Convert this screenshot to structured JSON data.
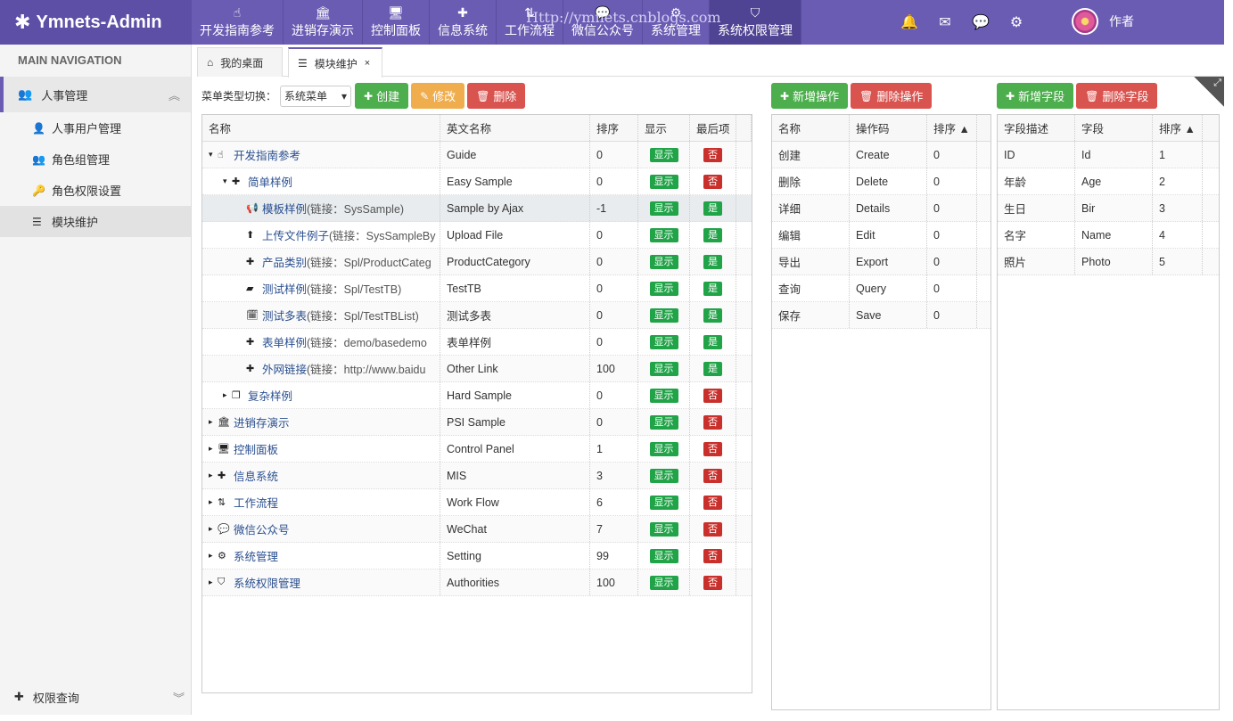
{
  "app": {
    "title": "Ymnets-Admin",
    "watermark": "Http://ymnets.cnblogs.com"
  },
  "topmenu": [
    {
      "label": "开发指南参考",
      "icon": "hand-pointer-icon",
      "glyph": "☝"
    },
    {
      "label": "进销存演示",
      "icon": "bank-icon",
      "glyph": "🏛"
    },
    {
      "label": "控制面板",
      "icon": "desktop-icon",
      "glyph": "🖥"
    },
    {
      "label": "信息系统",
      "icon": "puzzle-icon",
      "glyph": "✚"
    },
    {
      "label": "工作流程",
      "icon": "sort-icon",
      "glyph": "⇅"
    },
    {
      "label": "微信公众号",
      "icon": "wechat-icon",
      "glyph": "💬"
    },
    {
      "label": "系统管理",
      "icon": "cogs-icon",
      "glyph": "⚙"
    },
    {
      "label": "系统权限管理",
      "icon": "shield-icon",
      "glyph": "⛉"
    }
  ],
  "topicons": {
    "bell": "🔔",
    "mail": "✉",
    "chat": "💬",
    "gear": "⚙"
  },
  "user": {
    "name": "作者"
  },
  "sidebar": {
    "heading": "MAIN NAVIGATION",
    "group": {
      "label": "人事管理",
      "icon": "users-icon",
      "glyph": "👥",
      "chev": "︽"
    },
    "items": [
      {
        "label": "人事用户管理",
        "glyph": "👤"
      },
      {
        "label": "角色组管理",
        "glyph": "👥"
      },
      {
        "label": "角色权限设置",
        "glyph": "🔑"
      },
      {
        "label": "模块维护",
        "glyph": "☰"
      }
    ],
    "bottom": {
      "label": "权限查询",
      "glyph": "✚",
      "chev": "︾"
    }
  },
  "tabs": [
    {
      "label": "我的桌面",
      "glyph": "⌂"
    },
    {
      "label": "模块维护",
      "glyph": "☰",
      "close": "×"
    }
  ],
  "toolbar1": {
    "label": "菜单类型切换：",
    "select": "系统菜单",
    "select_arrow": "▾",
    "create": "创建",
    "edit": "修改",
    "delete": "删除",
    "plus": "✚",
    "pencil": "✎",
    "trash": "🗑"
  },
  "toolbar2": {
    "add": "新增操作",
    "delete": "删除操作",
    "plus": "✚",
    "trash": "🗑"
  },
  "toolbar3": {
    "add": "新增字段",
    "delete": "删除字段",
    "plus": "✚",
    "trash": "🗑"
  },
  "corner": "⤢",
  "modules": {
    "headers": [
      "名称",
      "英文名称",
      "排序",
      "显示",
      "最后项"
    ],
    "rows": [
      {
        "arrow": "▾",
        "indent": 0,
        "glyph": "☝",
        "name": "开发指南参考",
        "link": "",
        "en": "Guide",
        "sort": "0",
        "show": "显示",
        "last": "否"
      },
      {
        "arrow": "▾",
        "indent": 1,
        "glyph": "✚",
        "name": "简单样例",
        "link": "",
        "en": "Easy Sample",
        "sort": "0",
        "show": "显示",
        "last": "否"
      },
      {
        "arrow": "",
        "indent": 2,
        "glyph": "📢",
        "name": "模板样例",
        "link": " (链接：SysSample)",
        "en": "Sample by Ajax",
        "sort": "-1",
        "show": "显示",
        "last": "是"
      },
      {
        "arrow": "",
        "indent": 2,
        "glyph": "⬆",
        "name": "上传文件例子",
        "link": " (链接：SysSampleBy",
        "en": "Upload File",
        "sort": "0",
        "show": "显示",
        "last": "是"
      },
      {
        "arrow": "",
        "indent": 2,
        "glyph": "✚",
        "name": "产品类别",
        "link": " (链接：Spl/ProductCateg",
        "en": "ProductCategory",
        "sort": "0",
        "show": "显示",
        "last": "是"
      },
      {
        "arrow": "",
        "indent": 2,
        "glyph": "▰",
        "name": "测试样例",
        "link": " (链接：Spl/TestTB)",
        "en": "TestTB",
        "sort": "0",
        "show": "显示",
        "last": "是"
      },
      {
        "arrow": "",
        "indent": 2,
        "glyph": "🗓",
        "name": "测试多表",
        "link": " (链接：Spl/TestTBList)",
        "en": "测试多表",
        "sort": "0",
        "show": "显示",
        "last": "是"
      },
      {
        "arrow": "",
        "indent": 2,
        "glyph": "✚",
        "name": "表单样例",
        "link": " (链接：demo/basedemo",
        "en": "表单样例",
        "sort": "0",
        "show": "显示",
        "last": "是"
      },
      {
        "arrow": "",
        "indent": 2,
        "glyph": "✚",
        "name": "外网链接",
        "link": " (链接：http://www.baidu",
        "en": "Other Link",
        "sort": "100",
        "show": "显示",
        "last": "是"
      },
      {
        "arrow": "▸",
        "indent": 1,
        "glyph": "❐",
        "name": "复杂样例",
        "link": "",
        "en": "Hard Sample",
        "sort": "0",
        "show": "显示",
        "last": "否"
      },
      {
        "arrow": "▸",
        "indent": 0,
        "glyph": "🏛",
        "name": "进销存演示",
        "link": "",
        "en": "PSI Sample",
        "sort": "0",
        "show": "显示",
        "last": "否"
      },
      {
        "arrow": "▸",
        "indent": 0,
        "glyph": "🖥",
        "name": "控制面板",
        "link": "",
        "en": "Control Panel",
        "sort": "1",
        "show": "显示",
        "last": "否"
      },
      {
        "arrow": "▸",
        "indent": 0,
        "glyph": "✚",
        "name": "信息系统",
        "link": "",
        "en": "MIS",
        "sort": "3",
        "show": "显示",
        "last": "否"
      },
      {
        "arrow": "▸",
        "indent": 0,
        "glyph": "⇅",
        "name": "工作流程",
        "link": "",
        "en": "Work Flow",
        "sort": "6",
        "show": "显示",
        "last": "否"
      },
      {
        "arrow": "▸",
        "indent": 0,
        "glyph": "💬",
        "name": "微信公众号",
        "link": "",
        "en": "WeChat",
        "sort": "7",
        "show": "显示",
        "last": "否"
      },
      {
        "arrow": "▸",
        "indent": 0,
        "glyph": "⚙",
        "name": "系统管理",
        "link": "",
        "en": "Setting",
        "sort": "99",
        "show": "显示",
        "last": "否"
      },
      {
        "arrow": "▸",
        "indent": 0,
        "glyph": "⛉",
        "name": "系统权限管理",
        "link": "",
        "en": "Authorities",
        "sort": "100",
        "show": "显示",
        "last": "否"
      }
    ]
  },
  "operations": {
    "headers": [
      "名称",
      "操作码",
      "排序 ▲"
    ],
    "rows": [
      [
        "创建",
        "Create",
        "0"
      ],
      [
        "删除",
        "Delete",
        "0"
      ],
      [
        "详细",
        "Details",
        "0"
      ],
      [
        "编辑",
        "Edit",
        "0"
      ],
      [
        "导出",
        "Export",
        "0"
      ],
      [
        "查询",
        "Query",
        "0"
      ],
      [
        "保存",
        "Save",
        "0"
      ]
    ]
  },
  "fields": {
    "headers": [
      "字段描述",
      "字段",
      "排序 ▲"
    ],
    "rows": [
      [
        "ID",
        "Id",
        "1"
      ],
      [
        "年龄",
        "Age",
        "2"
      ],
      [
        "生日",
        "Bir",
        "3"
      ],
      [
        "名字",
        "Name",
        "4"
      ],
      [
        "照片",
        "Photo",
        "5"
      ]
    ]
  }
}
